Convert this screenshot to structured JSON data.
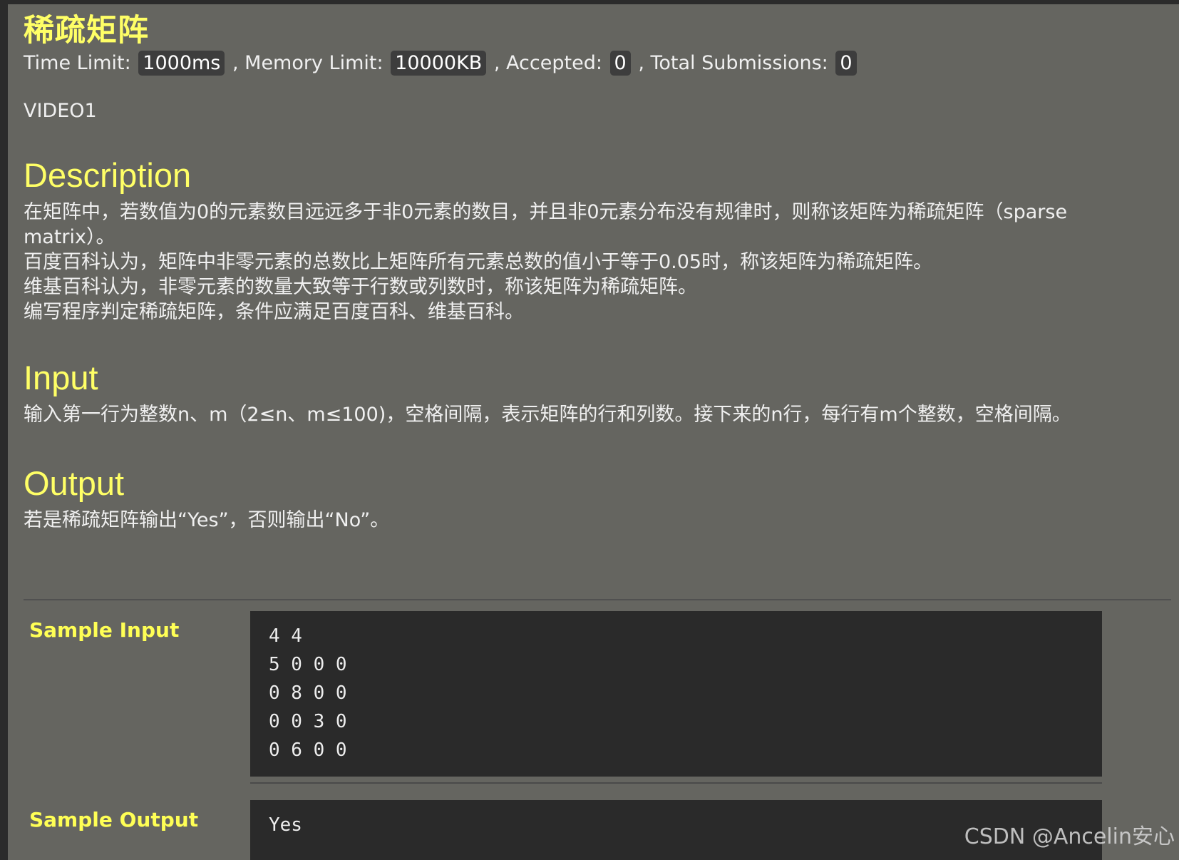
{
  "problem": {
    "title": "稀疏矩阵",
    "time_limit_label": "Time Limit:",
    "time_limit": "1000ms",
    "memory_limit_label": ", Memory Limit:",
    "memory_limit": "10000KB",
    "accepted_label": ", Accepted:",
    "accepted": "0",
    "submissions_label": ", Total Submissions:",
    "submissions": "0",
    "video_label": "VIDEO1"
  },
  "description": {
    "heading": "Description",
    "lines": [
      "在矩阵中，若数值为0的元素数目远远多于非0元素的数目，并且非0元素分布没有规律时，则称该矩阵为稀疏矩阵（sparse matrix）。",
      "百度百科认为，矩阵中非零元素的总数比上矩阵所有元素总数的值小于等于0.05时，称该矩阵为稀疏矩阵。",
      "维基百科认为，非零元素的数量大致等于行数或列数时，称该矩阵为稀疏矩阵。",
      "编写程序判定稀疏矩阵，条件应满足百度百科、维基百科。"
    ]
  },
  "input": {
    "heading": "Input",
    "text": "输入第一行为整数n、m（2≤n、m≤100)，空格间隔，表示矩阵的行和列数。接下来的n行，每行有m个整数，空格间隔。"
  },
  "output": {
    "heading": "Output",
    "text": "若是稀疏矩阵输出“Yes”，否则输出“No”。"
  },
  "sample_input": {
    "label": "Sample Input",
    "lines": [
      "4 4",
      "5 0 0 0",
      "0 8 0 0",
      "0 0 3 0",
      "0 6 0 0"
    ]
  },
  "sample_output": {
    "label": "Sample Output",
    "lines": [
      "Yes"
    ]
  },
  "watermark": "CSDN @Ancelin安心",
  "colors": {
    "heading": "#ffff66",
    "page_background": "#656560",
    "code_background": "#2a2a2a"
  }
}
